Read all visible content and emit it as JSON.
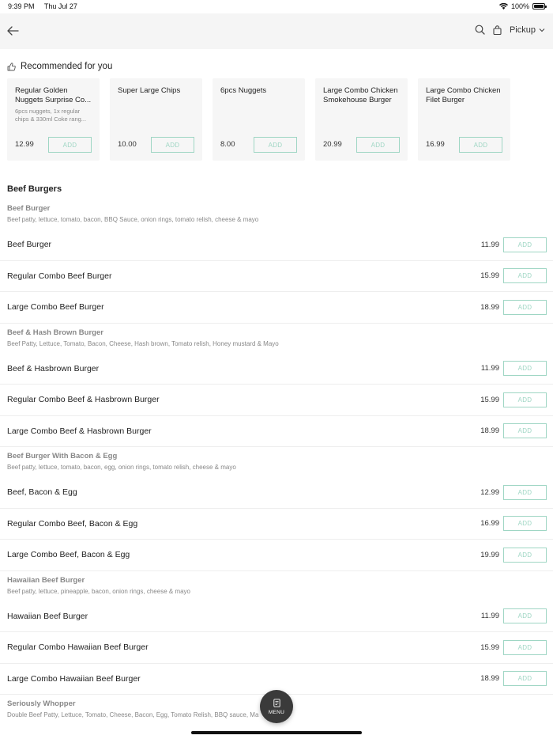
{
  "status_bar": {
    "time": "9:39 PM",
    "date": "Thu Jul 27",
    "battery": "100%"
  },
  "nav": {
    "pickup_label": "Pickup"
  },
  "icons": {
    "back": "arrow-left-icon",
    "search": "search-icon",
    "bag": "bag-icon",
    "thumb": "thumbs-up-icon",
    "menu": "menu-doc-icon"
  },
  "colors": {
    "accent": "#9fd6c4",
    "fab": "#3a3a3a"
  },
  "recommended": {
    "title": "Recommended for you",
    "items": [
      {
        "name": "Regular Golden Nuggets Surprise Co...",
        "desc": "6pcs nuggets, 1x regular chips & 330ml Coke rang...",
        "price": "12.99",
        "add": "ADD"
      },
      {
        "name": "Super Large Chips",
        "desc": "",
        "price": "10.00",
        "add": "ADD"
      },
      {
        "name": "6pcs Nuggets",
        "desc": "",
        "price": "8.00",
        "add": "ADD"
      },
      {
        "name": "Large Combo Chicken Smokehouse Burger",
        "desc": "",
        "price": "20.99",
        "add": "ADD"
      },
      {
        "name": "Large Combo Chicken Filet Burger",
        "desc": "",
        "price": "16.99",
        "add": "ADD"
      }
    ]
  },
  "section": {
    "title": "Beef Burgers"
  },
  "groups": [
    {
      "name": "Beef Burger",
      "desc": "Beef patty, lettuce, tomato, bacon, BBQ Sauce, onion rings, tomato relish, cheese & mayo",
      "items": [
        {
          "name": "Beef Burger",
          "price": "11.99",
          "add": "ADD"
        },
        {
          "name": "Regular Combo Beef Burger",
          "price": "15.99",
          "add": "ADD"
        },
        {
          "name": "Large Combo  Beef Burger",
          "price": "18.99",
          "add": "ADD"
        }
      ]
    },
    {
      "name": "Beef & Hash Brown Burger",
      "desc": "Beef Patty, Lettuce, Tomato, Bacon, Cheese, Hash brown, Tomato relish, Honey mustard & Mayo",
      "items": [
        {
          "name": "Beef & Hasbrown Burger",
          "price": "11.99",
          "add": "ADD"
        },
        {
          "name": "Regular Combo Beef & Hasbrown Burger",
          "price": "15.99",
          "add": "ADD"
        },
        {
          "name": "Large Combo  Beef & Hasbrown Burger",
          "price": "18.99",
          "add": "ADD"
        }
      ]
    },
    {
      "name": "Beef Burger With Bacon & Egg",
      "desc": "Beef patty, lettuce, tomato, bacon, egg, onion rings, tomato relish, cheese & mayo",
      "items": [
        {
          "name": "Beef, Bacon & Egg",
          "price": "12.99",
          "add": "ADD"
        },
        {
          "name": "Regular Combo Beef, Bacon & Egg",
          "price": "16.99",
          "add": "ADD"
        },
        {
          "name": "Large Combo  Beef, Bacon & Egg",
          "price": "19.99",
          "add": "ADD"
        }
      ]
    },
    {
      "name": "Hawaiian Beef Burger",
      "desc": "Beef patty, lettuce, pineapple, bacon, onion rings, cheese & mayo",
      "items": [
        {
          "name": "Hawaiian Beef Burger",
          "price": "11.99",
          "add": "ADD"
        },
        {
          "name": "Regular Combo Hawaiian Beef Burger",
          "price": "15.99",
          "add": "ADD"
        },
        {
          "name": "Large Combo  Hawaiian Beef Burger",
          "price": "18.99",
          "add": "ADD"
        }
      ]
    },
    {
      "name": "Seriously Whopper",
      "desc": "Double Beef Patty, Lettuce, Tomato, Cheese, Bacon, Egg, Tomato Relish, BBQ sauce, Ma",
      "items": []
    }
  ],
  "fab": {
    "label": "MENU"
  }
}
